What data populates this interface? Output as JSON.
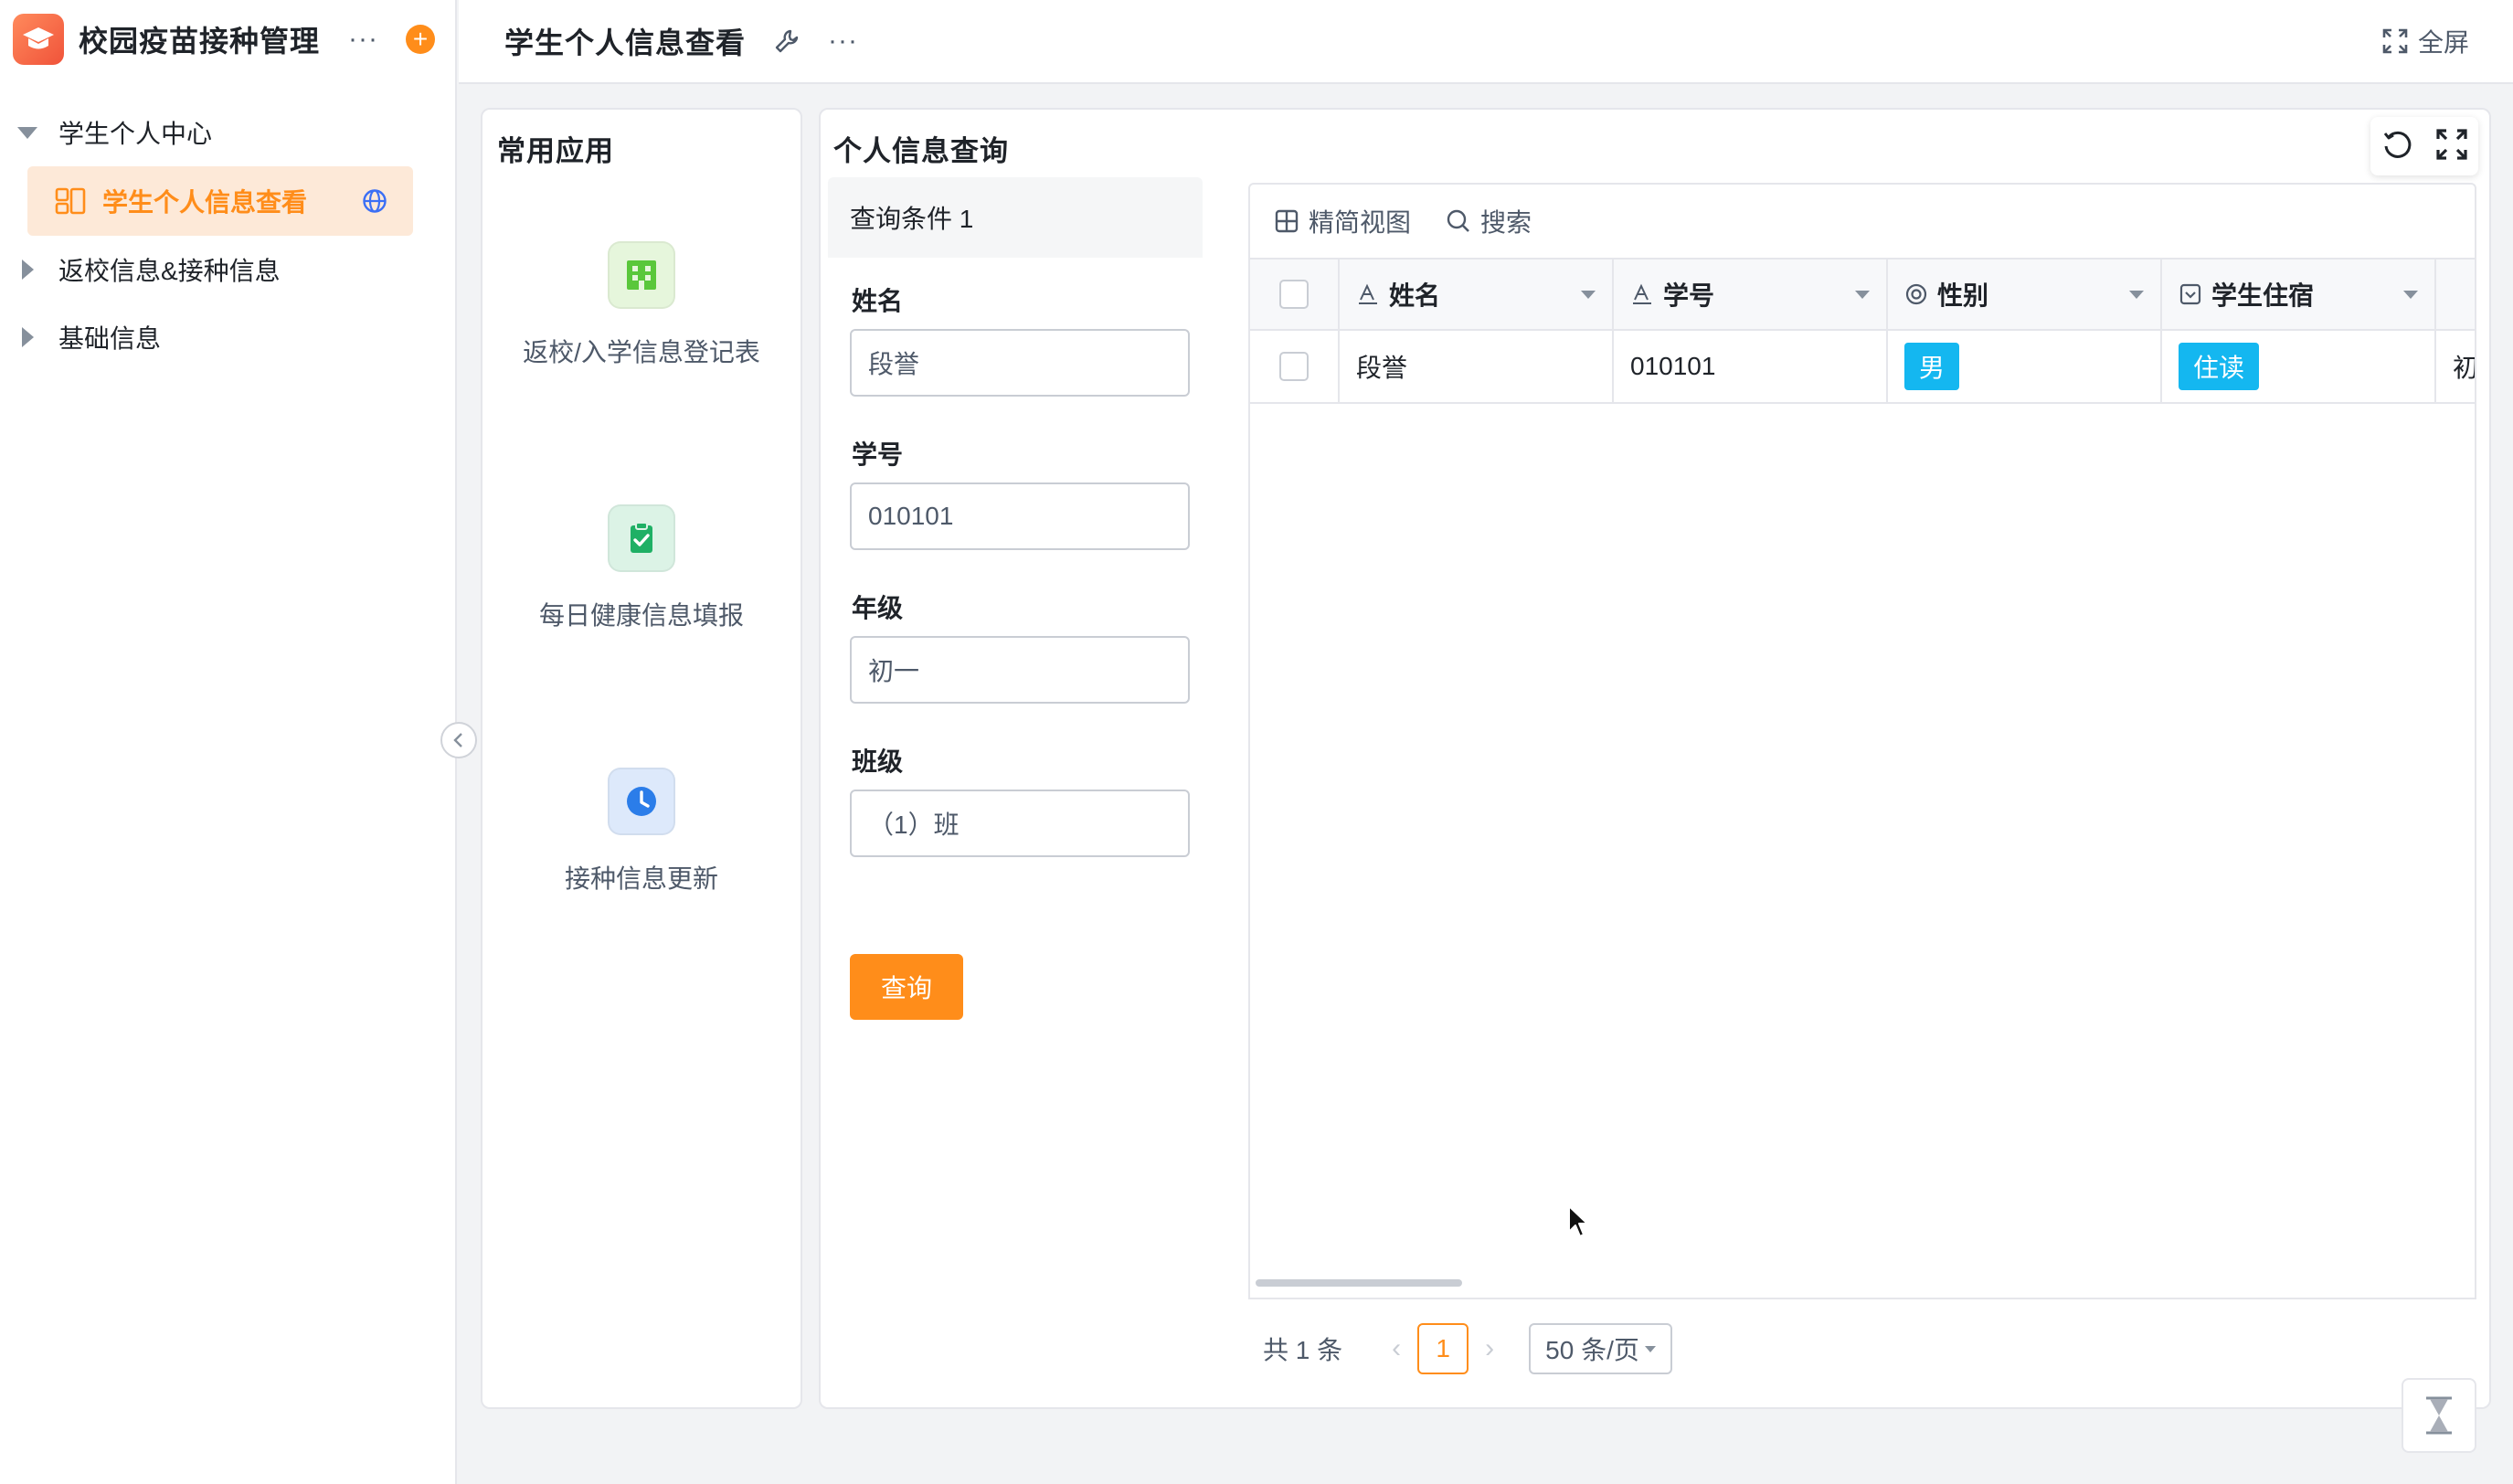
{
  "sidebar": {
    "app_title": "校园疫苗接种管理",
    "app_logo_icon": "graduation-cap-icon",
    "items": [
      {
        "label": "学生个人中心",
        "expanded": true
      },
      {
        "label": "学生个人信息查看",
        "active": true
      },
      {
        "label": "返校信息&接种信息",
        "expanded": false
      },
      {
        "label": "基础信息",
        "expanded": false
      }
    ],
    "accent_color": "#ff8d1a"
  },
  "topbar": {
    "page_title": "学生个人信息查看",
    "fullscreen_label": "全屏"
  },
  "common_apps": {
    "title": "常用应用",
    "apps": [
      {
        "label": "返校/入学信息登记表",
        "icon": "building-icon",
        "color": "#5ac73b"
      },
      {
        "label": "每日健康信息填报",
        "icon": "clipboard-check-icon",
        "color": "#1fb065"
      },
      {
        "label": "接种信息更新",
        "icon": "clock-icon",
        "color": "#2b7de9"
      }
    ]
  },
  "query": {
    "title": "个人信息查询",
    "condition_header": "查询条件 1",
    "fields": [
      {
        "label": "姓名",
        "value": "段誉"
      },
      {
        "label": "学号",
        "value": "010101"
      },
      {
        "label": "年级",
        "value": "初一"
      },
      {
        "label": "班级",
        "value": "（1）班"
      }
    ],
    "submit_label": "查询"
  },
  "table": {
    "toolbar": {
      "compact_view": "精简视图",
      "search": "搜索"
    },
    "columns": [
      {
        "label": "姓名",
        "icon": "text-field-icon"
      },
      {
        "label": "学号",
        "icon": "text-field-icon"
      },
      {
        "label": "性别",
        "icon": "radio-field-icon"
      },
      {
        "label": "学生住宿",
        "icon": "select-field-icon"
      }
    ],
    "rows": [
      {
        "name": "段誉",
        "student_id": "010101",
        "gender": "男",
        "dorm": "住读",
        "grade_partial": "初"
      }
    ],
    "tag_color": "#14b7f0"
  },
  "pagination": {
    "total": "共 1 条",
    "current_page": "1",
    "page_size": "50 条/页"
  }
}
